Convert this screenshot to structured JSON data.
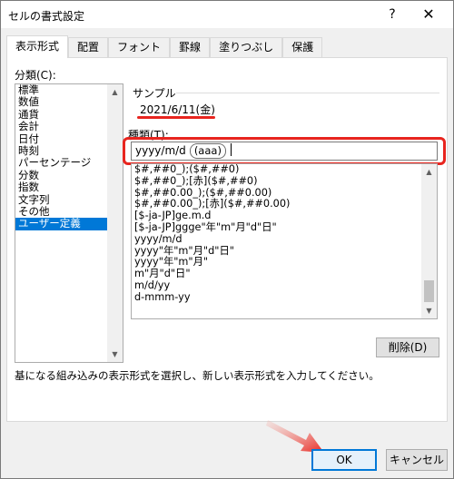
{
  "dialog": {
    "title": "セルの書式設定",
    "help": "?",
    "close": "✕"
  },
  "tabs": [
    {
      "label": "表示形式",
      "active": true
    },
    {
      "label": "配置",
      "active": false
    },
    {
      "label": "フォント",
      "active": false
    },
    {
      "label": "罫線",
      "active": false
    },
    {
      "label": "塗りつぶし",
      "active": false
    },
    {
      "label": "保護",
      "active": false
    }
  ],
  "category": {
    "label": "分類(C):",
    "items": [
      "標準",
      "数値",
      "通貨",
      "会計",
      "日付",
      "時刻",
      "パーセンテージ",
      "分数",
      "指数",
      "文字列",
      "その他",
      "ユーザー定義"
    ],
    "selected": "ユーザー定義"
  },
  "sample": {
    "label": "サンプル",
    "value": "2021/6/11(金)"
  },
  "type": {
    "label": "種類(T):",
    "input_prefix": "yyyy/m/d",
    "input_highlight": "(aaa)"
  },
  "formats": [
    "$#,##0_);($#,##0)",
    "$#,##0_);[赤]($#,##0)",
    "$#,##0.00_);($#,##0.00)",
    "$#,##0.00_);[赤]($#,##0.00)",
    "[$-ja-JP]ge.m.d",
    "[$-ja-JP]ggge\"年\"m\"月\"d\"日\"",
    "yyyy/m/d",
    "yyyy\"年\"m\"月\"d\"日\"",
    "yyyy\"年\"m\"月\"",
    "m\"月\"d\"日\"",
    "m/d/yy",
    "d-mmm-yy"
  ],
  "buttons": {
    "delete": "削除(D)",
    "ok": "OK",
    "cancel": "キャンセル"
  },
  "description": "基になる組み込みの表示形式を選択し、新しい表示形式を入力してください。",
  "colors": {
    "accent": "#0078d7",
    "annotation": "#e8251f"
  }
}
